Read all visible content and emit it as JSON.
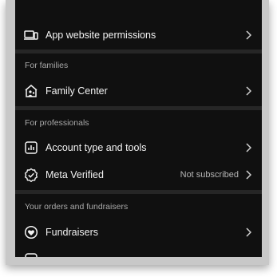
{
  "settings": {
    "app_website_permissions": "App website permissions",
    "for_families_header": "For families",
    "family_center": "Family Center",
    "for_professionals_header": "For professionals",
    "account_type_tools": "Account type and tools",
    "meta_verified": "Meta Verified",
    "meta_verified_status": "Not subscribed",
    "orders_header": "Your orders and fundraisers",
    "fundraisers": "Fundraisers"
  },
  "icons": {
    "app_website_permissions": "device-icon",
    "family_center": "family-home-icon",
    "account_type_tools": "bar-chart-icon",
    "meta_verified": "verified-badge-icon",
    "fundraisers": "fundraiser-icon",
    "chevron": "chevron-right-icon"
  },
  "colors": {
    "panel_bg": "#101010",
    "divider": "#262626",
    "text_primary": "#f2f2f2",
    "text_secondary": "#a8a8a8"
  }
}
